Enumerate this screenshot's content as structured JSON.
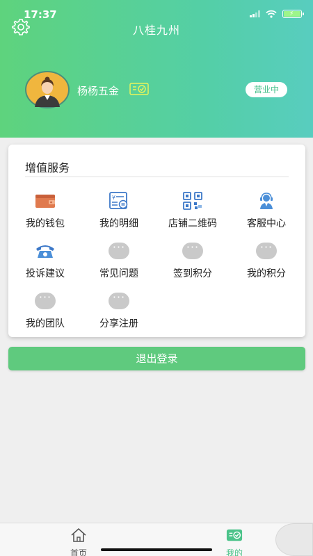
{
  "status": {
    "time": "17:37"
  },
  "header": {
    "title": "八桂九州",
    "shop_name": "杨杨五金",
    "open_status": "营业中"
  },
  "services": {
    "title": "增值服务",
    "items": [
      {
        "label": "我的钱包",
        "icon": "wallet-icon"
      },
      {
        "label": "我的明细",
        "icon": "ledger-icon"
      },
      {
        "label": "店铺二维码",
        "icon": "qrcode-icon"
      },
      {
        "label": "客服中心",
        "icon": "customer-service-icon"
      },
      {
        "label": "投诉建议",
        "icon": "telephone-icon"
      },
      {
        "label": "常见问题",
        "icon": "more-dots-icon"
      },
      {
        "label": "签到积分",
        "icon": "more-dots-icon"
      },
      {
        "label": "我的积分",
        "icon": "more-dots-icon"
      },
      {
        "label": "我的团队",
        "icon": "more-dots-icon"
      },
      {
        "label": "分享注册",
        "icon": "more-dots-icon"
      }
    ]
  },
  "logout_label": "退出登录",
  "tabbar": {
    "home_label": "首页",
    "mine_label": "我的",
    "active_color": "#4cc38a",
    "inactive_color": "#555555"
  },
  "colors": {
    "brand_green": "#5fca7e",
    "header_start": "#5ed37d",
    "header_end": "#58cdbf"
  }
}
